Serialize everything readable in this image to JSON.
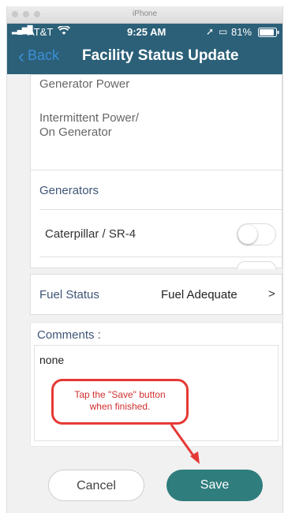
{
  "simulator": {
    "title": "iPhone"
  },
  "status_bar": {
    "carrier": "AT&T",
    "time": "9:25 AM",
    "battery": "81%"
  },
  "nav": {
    "back_label": "Back",
    "title": "Facility Status Update"
  },
  "power": {
    "option_1": "Generator Power",
    "option_2_line1": "Intermittent Power/",
    "option_2_line2": "On Generator"
  },
  "generators": {
    "header": "Generators",
    "items": [
      {
        "label": "Caterpillar / SR-4",
        "enabled": false
      }
    ]
  },
  "fuel": {
    "label": "Fuel Status",
    "value": "Fuel Adequate",
    "chevron": ">"
  },
  "comments": {
    "label": "Comments :",
    "value": "none"
  },
  "annotation": {
    "line1": "Tap the \"Save\" button",
    "line2": "when finished."
  },
  "buttons": {
    "cancel": "Cancel",
    "save": "Save"
  },
  "colors": {
    "nav_bg": "#2b6078",
    "back": "#3d8fd8",
    "save_bg": "#2f7d7d",
    "annotation": "#e53935"
  }
}
